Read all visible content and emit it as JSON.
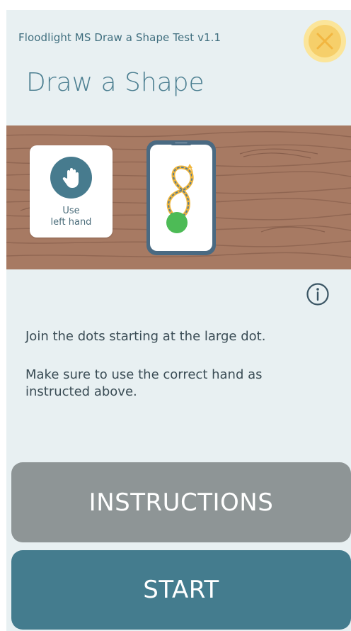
{
  "header": {
    "app_name": "Floodlight MS Draw a Shape Test v1.1",
    "page_title": "Draw a Shape"
  },
  "hand_card": {
    "line1": "Use",
    "line2": "left hand"
  },
  "instructions_text": {
    "line1": "Join the dots starting at the large dot.",
    "line2": "Make sure to use the correct hand as instructed above."
  },
  "buttons": {
    "instructions_label": "INSTRUCTIONS",
    "start_label": "START"
  },
  "colors": {
    "background": "#e8f0f2",
    "title": "#4c7f91",
    "close_outer": "#fbe59a",
    "close_inner": "#f6cf6a",
    "wood": "#a77a63",
    "hand_circle": "#477b8e",
    "instructions_button": "#8e9596",
    "start_button": "#447c8e",
    "shape_line": "#f0b63c",
    "start_dot": "#4dbb56"
  },
  "icons": {
    "close": "close-icon",
    "hand": "hand-icon",
    "info": "info-icon"
  }
}
